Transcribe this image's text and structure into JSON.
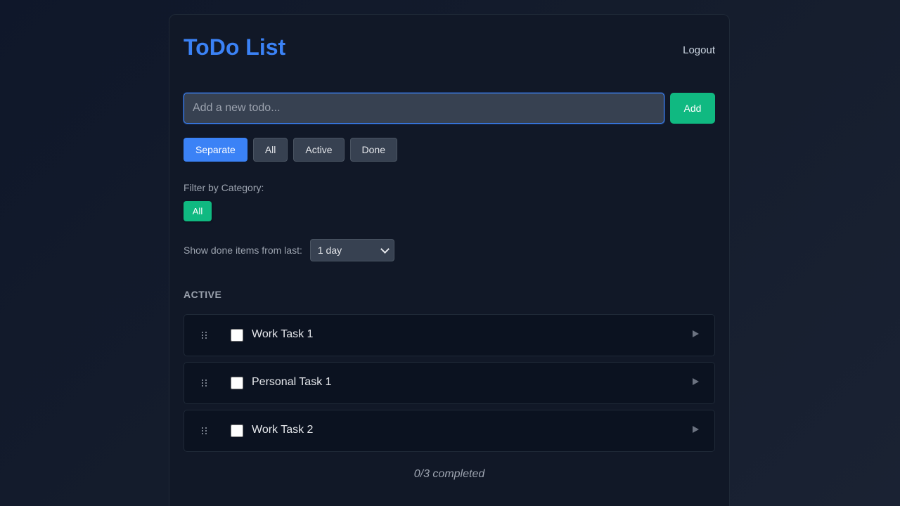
{
  "app": {
    "title": "ToDo List",
    "logout_label": "Logout"
  },
  "add_todo": {
    "placeholder": "Add a new todo...",
    "value": "",
    "button_label": "Add"
  },
  "view_tabs": [
    {
      "label": "Separate",
      "active": true
    },
    {
      "label": "All",
      "active": false
    },
    {
      "label": "Active",
      "active": false
    },
    {
      "label": "Done",
      "active": false
    }
  ],
  "category_filter": {
    "label": "Filter by Category:",
    "categories": [
      {
        "label": "All",
        "selected": true
      }
    ]
  },
  "done_filter": {
    "label": "Show done items from last:",
    "selected": "1 day"
  },
  "sections": {
    "active": {
      "heading": "ACTIVE",
      "items": [
        {
          "text": "Work Task 1",
          "checked": false
        },
        {
          "text": "Personal Task 1",
          "checked": false
        },
        {
          "text": "Work Task 2",
          "checked": false
        }
      ]
    }
  },
  "summary": "0/3 completed",
  "colors": {
    "accent": "#3b82f6",
    "success": "#10b981",
    "background": "#0f172a",
    "card": "#111827"
  },
  "icons": {
    "drag_handle": "drag-handle-icon",
    "expand": "chevron-right-icon",
    "select": "chevron-down-icon"
  }
}
